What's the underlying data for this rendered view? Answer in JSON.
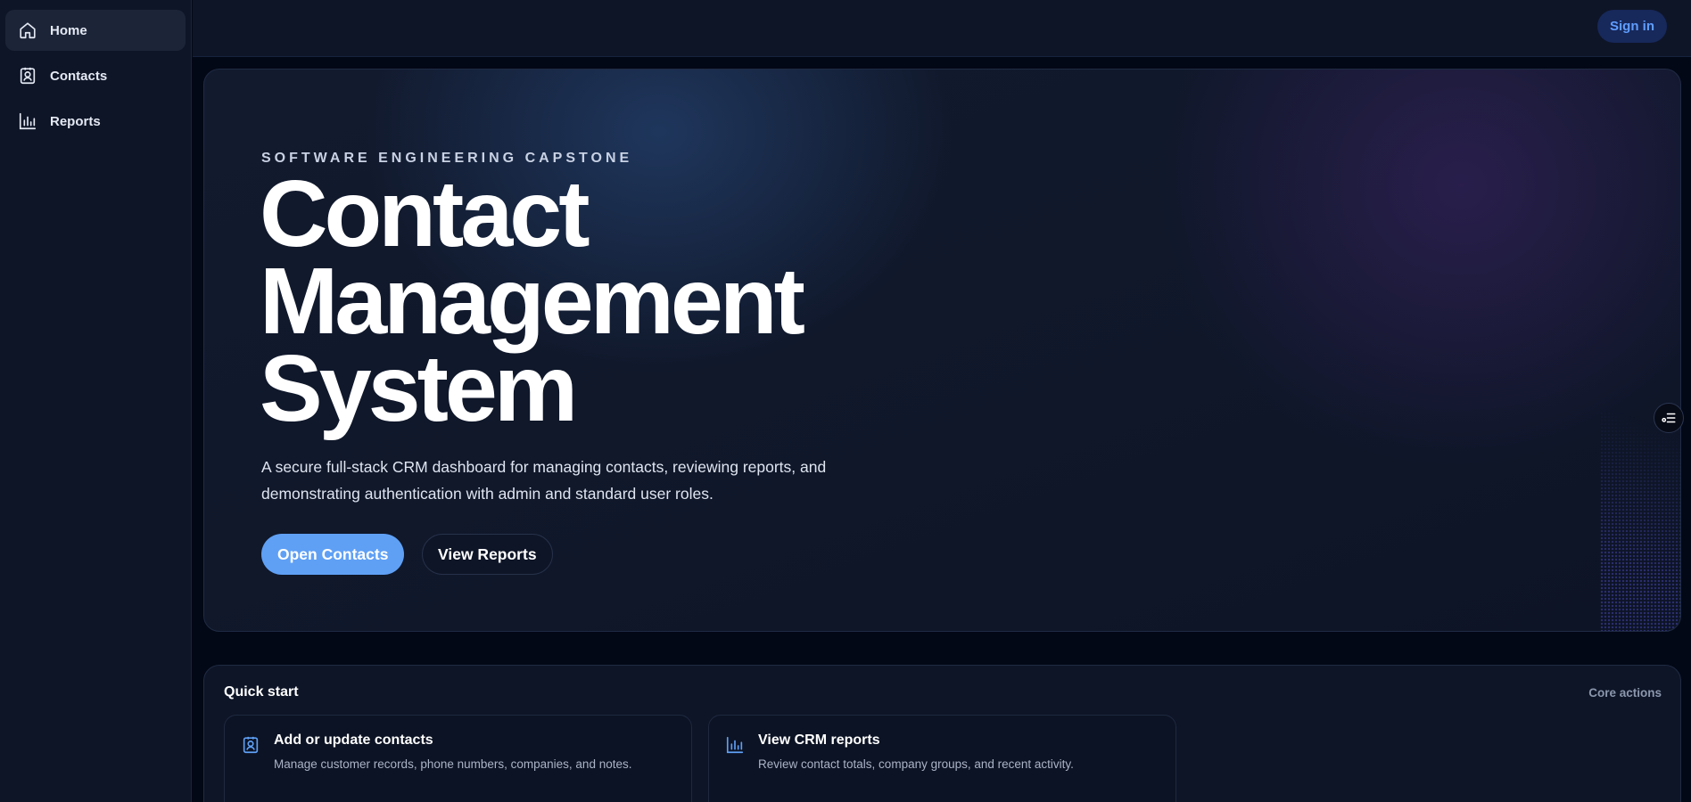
{
  "sidebar": {
    "items": [
      {
        "label": "Home",
        "icon": "home-icon",
        "active": true
      },
      {
        "label": "Contacts",
        "icon": "contacts-icon",
        "active": false
      },
      {
        "label": "Reports",
        "icon": "bar-chart-icon",
        "active": false
      }
    ]
  },
  "topbar": {
    "signin_label": "Sign in"
  },
  "hero": {
    "eyebrow": "SOFTWARE ENGINEERING CAPSTONE",
    "title_line1": "Contact",
    "title_line2": "Management",
    "title_line3": "System",
    "description_line1": "A secure full-stack CRM dashboard for managing contacts, reviewing reports, and",
    "description_line2": "demonstrating authentication with admin and standard user roles.",
    "primary_label": "Open Contacts",
    "secondary_label": "View Reports",
    "handle_icon": "settings-list-icon"
  },
  "quick_start": {
    "title": "Quick start",
    "meta": "Core actions",
    "cards": [
      {
        "title": "Add or update contacts",
        "description": "Manage customer records, phone numbers, companies, and notes.",
        "icon": "contacts-icon"
      },
      {
        "title": "View CRM reports",
        "description": "Review contact totals, company groups, and recent activity.",
        "icon": "bar-chart-icon"
      }
    ]
  },
  "colors": {
    "background": "#030816",
    "panel": "#0e1527",
    "accent": "#5fa0f5",
    "signin_text": "#5f9dff",
    "signin_bg": "#17285a"
  }
}
